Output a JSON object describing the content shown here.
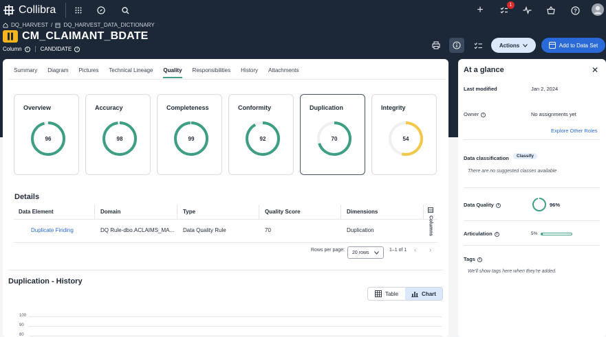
{
  "app": {
    "name": "Collibra",
    "notifications_count": "1"
  },
  "breadcrumb": {
    "community": "DQ_HARVEST",
    "sep": "/",
    "domain": "DQ_HARVEST_DATA_DICTIONARY"
  },
  "asset": {
    "title": "CM_CLAIMANT_BDATE",
    "type": "Column",
    "status": "CANDIDATE"
  },
  "toolbar": {
    "actions_label": "Actions",
    "add_label": "Add to Data Set"
  },
  "tabs": [
    "Summary",
    "Diagram",
    "Pictures",
    "Technical Lineage",
    "Quality",
    "Responsibilities",
    "History",
    "Attachments"
  ],
  "active_tab": "Quality",
  "scores": [
    {
      "name": "Overview",
      "value": 96,
      "color": "#3f9f84"
    },
    {
      "name": "Accuracy",
      "value": 98,
      "color": "#3f9f84"
    },
    {
      "name": "Completeness",
      "value": 99,
      "color": "#3f9f84"
    },
    {
      "name": "Conformity",
      "value": 92,
      "color": "#3f9f84"
    },
    {
      "name": "Duplication",
      "value": 70,
      "color": "#3f9f84"
    },
    {
      "name": "Integrity",
      "value": 54,
      "color": "#f2c84b"
    }
  ],
  "details": {
    "heading": "Details",
    "columns": [
      "Data Element",
      "Domain",
      "Type",
      "Quality Score",
      "Dimensions"
    ],
    "rows": [
      [
        "Duplicate Finding",
        "DQ Rule-dbo.ACLAIMS_MA...",
        "Data Quality Rule",
        "70",
        "Duplication"
      ]
    ],
    "columns_button": "Columns",
    "rows_per_page_label": "Rows per page:",
    "rows_per_page_value": "20 rows",
    "page_range": "1–1 of 1"
  },
  "history": {
    "heading": "Duplication - History",
    "table_label": "Table",
    "chart_label": "Chart",
    "y_ticks": [
      "100",
      "90",
      "80"
    ]
  },
  "glance": {
    "title": "At a glance",
    "last_modified_label": "Last modified",
    "last_modified_value": "Jan 2, 2024",
    "owner_label": "Owner",
    "owner_value": "No assignments yet",
    "explore_link": "Explore Other Roles",
    "classification_label": "Data classification",
    "classify_chip": "Classify",
    "classification_empty": "There are no suggested classes available",
    "dq_label": "Data Quality",
    "dq_value": "96%",
    "dq_fraction": 0.96,
    "articulation_label": "Articulation",
    "articulation_value": "5%",
    "articulation_fraction": 0.05,
    "tags_label": "Tags",
    "tags_empty": "We'll show tags here when they're added."
  }
}
